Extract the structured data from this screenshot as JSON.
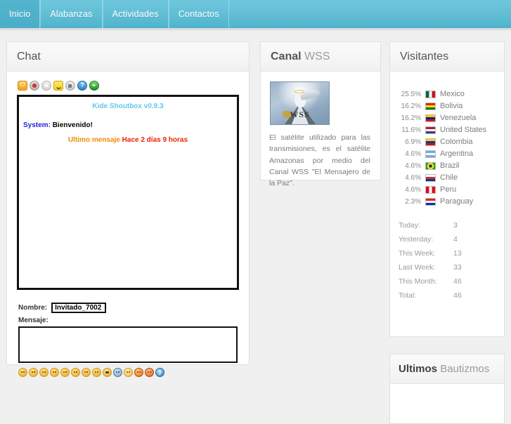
{
  "nav": {
    "tabs": [
      {
        "label": "Inicio",
        "active": true
      },
      {
        "label": "Alabanzas",
        "active": false
      },
      {
        "label": "Actividades",
        "active": false
      },
      {
        "label": "Contactos",
        "active": false
      }
    ]
  },
  "chat": {
    "title": "Chat",
    "toolbar": [
      {
        "icon": "power-icon"
      },
      {
        "icon": "block-icon"
      },
      {
        "icon": "gear-icon"
      },
      {
        "icon": "smiley-icon"
      },
      {
        "icon": "sound-icon"
      },
      {
        "icon": "help-icon"
      },
      {
        "icon": "globe-icon"
      }
    ],
    "shoutbox_title": "Kide Shoutbox v0.9.3",
    "messages": [
      {
        "author": "System",
        "separator": ":",
        "text": "Bienvenido!"
      }
    ],
    "last_message_label": "Ultimo mensaje",
    "last_message_value": "Hace 2 días 9 horas",
    "name_label": "Nombre:",
    "name_value": "Invitado_7002",
    "name_placeholder": "",
    "message_label": "Mensaje:",
    "message_value": "",
    "message_placeholder": "",
    "emoticons": [
      "smile-emoticon",
      "sad-emoticon",
      "neutral-emoticon",
      "tongue-emoticon",
      "zipped-emoticon",
      "confused-emoticon",
      "shocked-emoticon",
      "wink-emoticon",
      "crazy-emoticon",
      "cool-emoticon",
      "angel-emoticon",
      "kiss-emoticon",
      "angry-emoticon",
      "question-emoticon"
    ]
  },
  "wss": {
    "title_strong": "Canal",
    "title_muted": "WSS",
    "logo_text": "WSS",
    "description": "El satélite utilizado para las transmisiones, es el satélite Amazonas por medio del Canal WSS \"El Mensajero de la Paz\"."
  },
  "visitantes": {
    "title": "Visitantes",
    "rows": [
      {
        "pct": "25.5%",
        "country": "Mexico",
        "flag": [
          "#006847",
          "#ffffff",
          "#ce1126"
        ],
        "dir": "v"
      },
      {
        "pct": "16.2%",
        "country": "Bolivia",
        "flag": [
          "#d52b1e",
          "#f9e300",
          "#007934"
        ],
        "dir": "h"
      },
      {
        "pct": "16.2%",
        "country": "Venezuela",
        "flag": [
          "#ffcc00",
          "#00247d",
          "#cf142b"
        ],
        "dir": "h"
      },
      {
        "pct": "11.6%",
        "country": "United States",
        "flag": [
          "#b22234",
          "#ffffff",
          "#3c3b6e"
        ],
        "dir": "h"
      },
      {
        "pct": "6.9%",
        "country": "Colombia",
        "flag": [
          "#fcd116",
          "#003893",
          "#ce1126"
        ],
        "dir": "h"
      },
      {
        "pct": "4.6%",
        "country": "Argentina",
        "flag": [
          "#74acdf",
          "#ffffff",
          "#74acdf"
        ],
        "dir": "h"
      },
      {
        "pct": "4.6%",
        "country": "Brazil",
        "flag": [
          "#009c3b",
          "#ffdf00",
          "#002776"
        ],
        "dir": "c"
      },
      {
        "pct": "4.6%",
        "country": "Chile",
        "flag": [
          "#ffffff",
          "#d52b1e",
          "#0039a6"
        ],
        "dir": "h"
      },
      {
        "pct": "4.6%",
        "country": "Peru",
        "flag": [
          "#d91023",
          "#ffffff",
          "#d91023"
        ],
        "dir": "v"
      },
      {
        "pct": "2.3%",
        "country": "Paraguay",
        "flag": [
          "#d52b1e",
          "#ffffff",
          "#0038a8"
        ],
        "dir": "h"
      }
    ],
    "stats": [
      {
        "label": "Today:",
        "value": "3"
      },
      {
        "label": "Yesterday:",
        "value": "4"
      },
      {
        "label": "This Week:",
        "value": "13"
      },
      {
        "label": "Last Week:",
        "value": "33"
      },
      {
        "label": "This Month:",
        "value": "46"
      },
      {
        "label": "Total:",
        "value": "46"
      }
    ]
  },
  "bautizmos": {
    "title_strong": "Ultimos",
    "title_muted": "Bautizmos"
  },
  "colors": {
    "nav_top": "#6fc7dd",
    "nav_bottom": "#4fb3cd",
    "nav_active": "#55b4cd",
    "page_bg": "#f0f0f0",
    "panel_bg": "#ffffff",
    "shoutbox_title": "#5ec8e8",
    "system_name": "#2222dd",
    "last_msg_label": "#f08a00",
    "last_msg_value": "#ee2200"
  }
}
